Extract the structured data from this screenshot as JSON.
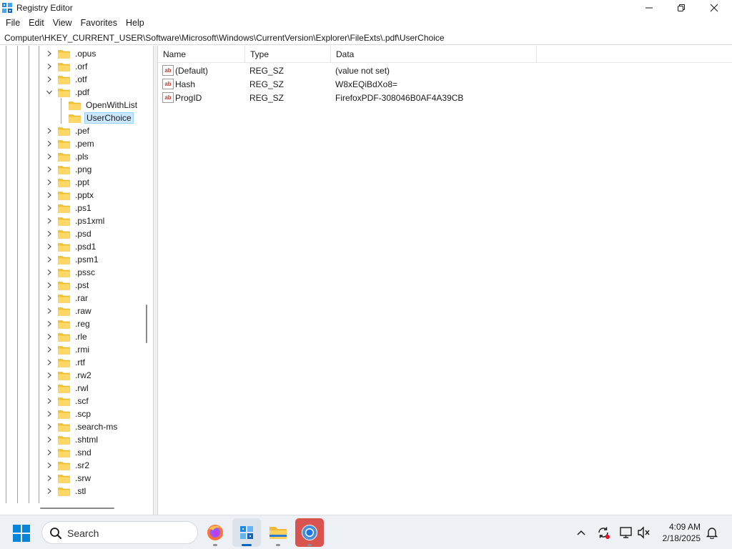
{
  "window": {
    "title": "Registry Editor",
    "minimize_label": "Minimize",
    "maximize_label": "Restore",
    "close_label": "Close"
  },
  "menu": [
    "File",
    "Edit",
    "View",
    "Favorites",
    "Help"
  ],
  "address": "Computer\\HKEY_CURRENT_USER\\Software\\Microsoft\\Windows\\CurrentVersion\\Explorer\\FileExts\\.pdf\\UserChoice",
  "tree": [
    {
      "label": ".opus",
      "level": 0,
      "state": "collapsed"
    },
    {
      "label": ".orf",
      "level": 0,
      "state": "collapsed"
    },
    {
      "label": ".otf",
      "level": 0,
      "state": "collapsed"
    },
    {
      "label": ".pdf",
      "level": 0,
      "state": "expanded"
    },
    {
      "label": "OpenWithList",
      "level": 1,
      "state": "none"
    },
    {
      "label": "UserChoice",
      "level": 1,
      "state": "none",
      "selected": true
    },
    {
      "label": ".pef",
      "level": 0,
      "state": "collapsed"
    },
    {
      "label": ".pem",
      "level": 0,
      "state": "collapsed"
    },
    {
      "label": ".pls",
      "level": 0,
      "state": "collapsed"
    },
    {
      "label": ".png",
      "level": 0,
      "state": "collapsed"
    },
    {
      "label": ".ppt",
      "level": 0,
      "state": "collapsed"
    },
    {
      "label": ".pptx",
      "level": 0,
      "state": "collapsed"
    },
    {
      "label": ".ps1",
      "level": 0,
      "state": "collapsed"
    },
    {
      "label": ".ps1xml",
      "level": 0,
      "state": "collapsed"
    },
    {
      "label": ".psd",
      "level": 0,
      "state": "collapsed"
    },
    {
      "label": ".psd1",
      "level": 0,
      "state": "collapsed"
    },
    {
      "label": ".psm1",
      "level": 0,
      "state": "collapsed"
    },
    {
      "label": ".pssc",
      "level": 0,
      "state": "collapsed"
    },
    {
      "label": ".pst",
      "level": 0,
      "state": "collapsed"
    },
    {
      "label": ".rar",
      "level": 0,
      "state": "collapsed"
    },
    {
      "label": ".raw",
      "level": 0,
      "state": "collapsed"
    },
    {
      "label": ".reg",
      "level": 0,
      "state": "collapsed"
    },
    {
      "label": ".rle",
      "level": 0,
      "state": "collapsed"
    },
    {
      "label": ".rmi",
      "level": 0,
      "state": "collapsed"
    },
    {
      "label": ".rtf",
      "level": 0,
      "state": "collapsed"
    },
    {
      "label": ".rw2",
      "level": 0,
      "state": "collapsed"
    },
    {
      "label": ".rwl",
      "level": 0,
      "state": "collapsed"
    },
    {
      "label": ".scf",
      "level": 0,
      "state": "collapsed"
    },
    {
      "label": ".scp",
      "level": 0,
      "state": "collapsed"
    },
    {
      "label": ".search-ms",
      "level": 0,
      "state": "collapsed"
    },
    {
      "label": ".shtml",
      "level": 0,
      "state": "collapsed"
    },
    {
      "label": ".snd",
      "level": 0,
      "state": "collapsed"
    },
    {
      "label": ".sr2",
      "level": 0,
      "state": "collapsed"
    },
    {
      "label": ".srw",
      "level": 0,
      "state": "collapsed"
    },
    {
      "label": ".stl",
      "level": 0,
      "state": "collapsed"
    }
  ],
  "list": {
    "columns": [
      "Name",
      "Type",
      "Data"
    ],
    "rows": [
      {
        "name": "(Default)",
        "type": "REG_SZ",
        "data": "(value not set)",
        "icon": "string-value-icon"
      },
      {
        "name": "Hash",
        "type": "REG_SZ",
        "data": "W8xEQiBdXo8=",
        "icon": "string-value-icon"
      },
      {
        "name": "ProgID",
        "type": "REG_SZ",
        "data": "FirefoxPDF-308046B0AF4A39CB",
        "icon": "string-value-icon"
      }
    ]
  },
  "taskbar": {
    "search_placeholder": "Search",
    "apps": [
      {
        "name": "firefox",
        "icon": "firefox-icon",
        "running": true,
        "active": false
      },
      {
        "name": "regedit",
        "icon": "registry-editor-icon",
        "running": true,
        "active": true
      },
      {
        "name": "file-explorer",
        "icon": "folder-icon",
        "running": true,
        "active": false
      },
      {
        "name": "chrome",
        "icon": "chrome-icon",
        "running": true,
        "active": false
      }
    ],
    "time": "4:09 AM",
    "date": "2/18/2025"
  },
  "colors": {
    "selection_bg": "#cce8ff",
    "selection_border": "#99d1ff",
    "folder": "#f4c430",
    "accent": "#0067c0"
  }
}
